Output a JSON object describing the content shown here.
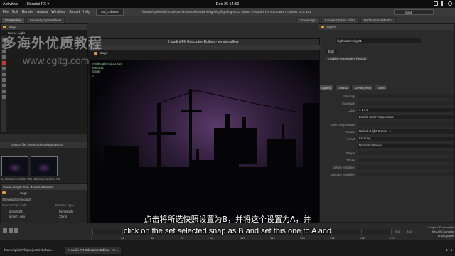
{
  "topbar": {
    "activities": "Activities",
    "app": "Houdini FX ▾",
    "clock": "Dec 26 14:56"
  },
  "menubar": {
    "menus": [
      "File",
      "Edit",
      "Render",
      "Assets",
      "Windows",
      "Arnold",
      "Help"
    ],
    "rotate": "sol_rotates",
    "window_title": "/home/opikis/vfx/projects/rebelWorks/solaris/lighting/lighting-v003.hipnc - Houdini FX Education Edition 18.5.351",
    "desktop": "Build"
  },
  "left_pane": {
    "tabs": [
      "Scene View",
      "Geometry Spreadsheet"
    ],
    "path": "stage",
    "subhead": "Scene Light"
  },
  "gallery": {
    "window_title": "Houdini FX Education Edition - rendergallery",
    "path": "stage",
    "info": [
      "rendergallery.db 1 size",
      "800x545",
      "Single",
      "0"
    ],
    "toolbar_label": "Source file: to Memory",
    "snaps": [
      {
        "caption": "3020-0.0"
      },
      {
        "caption": "3020-0.1"
      }
    ]
  },
  "left_snaps": {
    "source": "Source file: /home/opikis/vfx/projects/r",
    "items": [
      {
        "caption": "0 Dec 2020 02:53:53 PM"
      },
      {
        "caption": "0 Dec 2020 02:54:24 PM"
      }
    ]
  },
  "net_pane": {
    "tabs": [
      "Scene Graph Tree",
      "Material Palette"
    ],
    "path": "stage",
    "filter": "Showing  Scene graph",
    "col1": "Scene Graph Path",
    "col2": "Primitive Type",
    "rows": [
      {
        "name": "domelight1",
        "type": "DomeLight"
      },
      {
        "name": "lantern_geo",
        "type": "Xform"
      }
    ]
  },
  "params": {
    "tabs": [
      "Scene Light",
      "Context Options Editor",
      "Performance Monitor"
    ],
    "node_title": "dlight1",
    "path": "/lights/domelight1",
    "edit": "Edit",
    "note": "Initialize Parameters for Edit",
    "sections": [
      "Lighting",
      "Shadow",
      "Karma (beta)",
      "Arnold"
    ],
    "rows": [
      {
        "label": "Intensity",
        "value": ""
      },
      {
        "label": "Exposure",
        "value": ""
      },
      {
        "label": "Color",
        "value": "1        1        1.3"
      },
      {
        "label": "",
        "value": "Enable Color Temperature"
      },
      {
        "label": "Color Temperature",
        "value": ""
      },
      {
        "label": "Texture",
        "value": "Default (Light Texture...)"
      },
      {
        "label": "Format",
        "value": "Lat Long"
      },
      {
        "label": "",
        "value": "Normalize Power"
      },
      {
        "label": "Shape",
        "value": ""
      },
      {
        "label": "Diffuse",
        "value": ""
      },
      {
        "label": "Diffuse Multiplier",
        "value": ""
      },
      {
        "label": "Specular Multiplier",
        "value": ""
      }
    ]
  },
  "timeline": {
    "frames": [
      "1",
      "24",
      "48",
      "72",
      "96",
      "120",
      "144",
      "168",
      "192",
      "216",
      "240"
    ],
    "end_a": "240",
    "end_b": "240",
    "keys": [
      "0 keys, 0/0 channels",
      "Key All Channels",
      "Auto Update"
    ]
  },
  "taskbar": {
    "items": [
      "home/opikis/vfx/projects/rebelWo...",
      "Houdini FX Education Edition - re..."
    ],
    "counter": "1 / 4"
  },
  "watermark": {
    "cn": "多海外优质教程",
    "url": "www.cgltg.com"
  },
  "subtitles": {
    "cn": "点击将所选快照设置为B，并将这个设置为A，并",
    "en": "click on the set selected snap as B and set this one to A and"
  },
  "colors": {
    "accent": "#e09a3a",
    "background": "#2b2b2b",
    "render_purple": "#4a2d5a"
  }
}
